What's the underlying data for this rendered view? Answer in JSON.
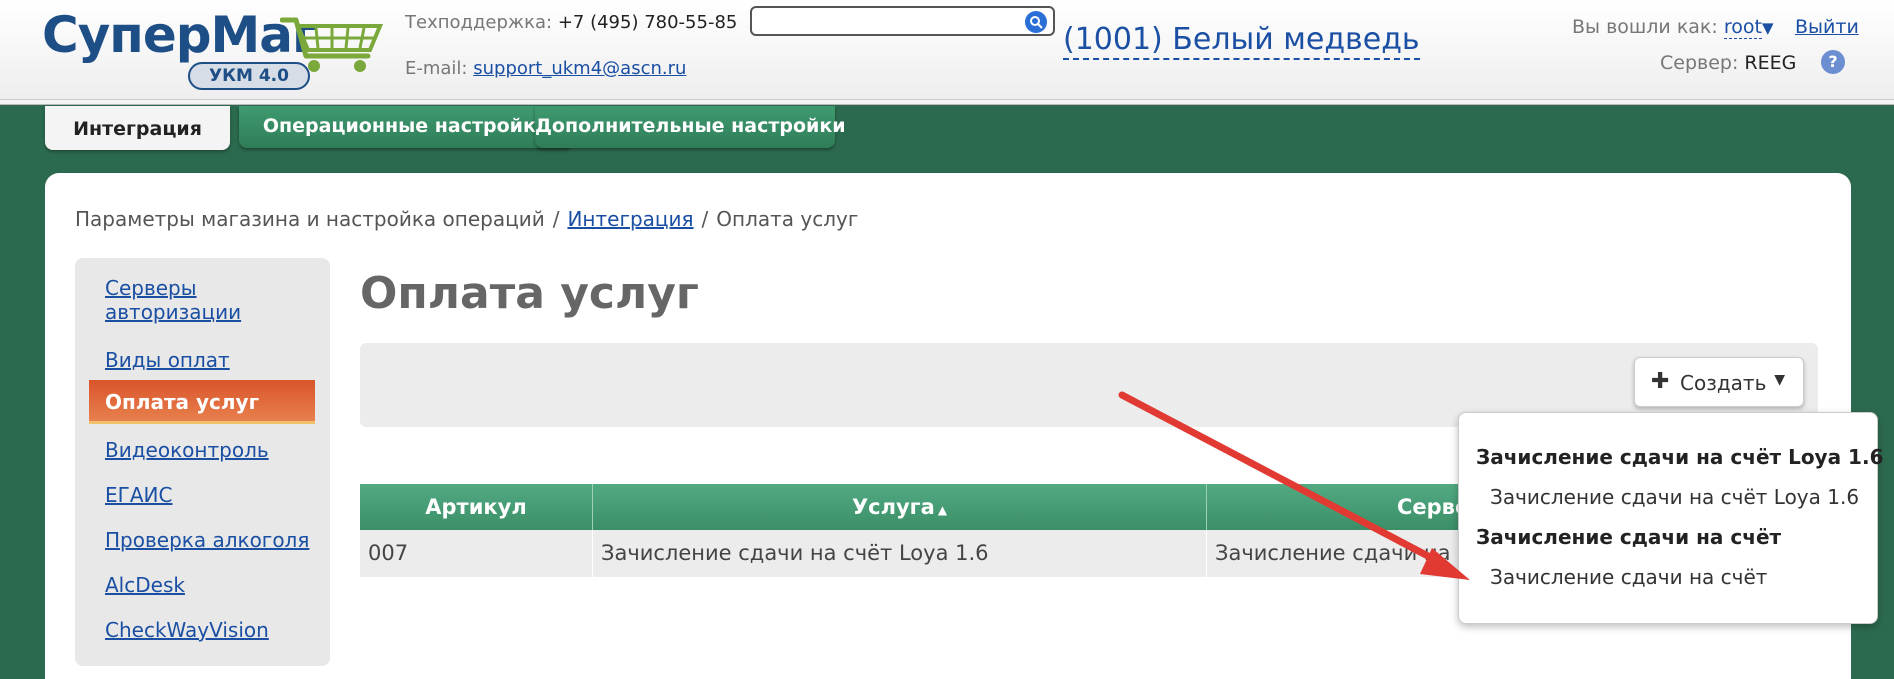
{
  "header": {
    "logo": {
      "title": "СуперМаг",
      "badge": "УКМ 4.0"
    },
    "support_label": "Техподдержка:",
    "support_phone": "+7 (495) 780-55-85",
    "email_label": "E-mail:",
    "email": "support_ukm4@ascn.ru",
    "search": {
      "value": "",
      "placeholder": ""
    },
    "store": "(1001) Белый медведь",
    "logged_in_label": "Вы вошли как:",
    "user": "root",
    "logout": "Выйти",
    "server_label": "Сервер:",
    "server": "REEG",
    "help": "?"
  },
  "tabs": [
    {
      "label": "Интеграция",
      "active": true
    },
    {
      "label": "Операционные настройки",
      "active": false
    },
    {
      "label": "Дополнительные настройки",
      "active": false
    }
  ],
  "breadcrumb": {
    "root": "Параметры магазина и настройка операций",
    "link": "Интеграция",
    "current": "Оплата услуг",
    "separator": "/"
  },
  "sidebar": {
    "items": [
      {
        "label": "Серверы авторизации",
        "active": false
      },
      {
        "label": "Виды оплат",
        "active": false
      },
      {
        "label": "Оплата услуг",
        "active": true
      },
      {
        "label": "Видеоконтроль",
        "active": false
      },
      {
        "label": "ЕГАИС",
        "active": false
      },
      {
        "label": "Проверка алкоголя",
        "active": false
      },
      {
        "label": "AlcDesk",
        "active": false
      },
      {
        "label": "CheckWayVision",
        "active": false
      }
    ]
  },
  "page_title": "Оплата услуг",
  "toolbar": {
    "create_label": "Создать",
    "create_icon": "plus-icon"
  },
  "table": {
    "columns": [
      "Артикул",
      "Услуга",
      "Серве"
    ],
    "sort_column": "Услуга",
    "rows": [
      {
        "article": "007",
        "service": "Зачисление сдачи на счёт Loya 1.6",
        "server": "Зачисление сдачи на"
      }
    ]
  },
  "create_menu": {
    "groups": [
      {
        "title": "Зачисление сдачи на счёт Loya 1.6",
        "items": [
          "Зачисление сдачи на счёт Loya 1.6"
        ]
      },
      {
        "title": "Зачисление сдачи на счёт",
        "items": [
          "Зачисление сдачи на счёт"
        ]
      }
    ]
  },
  "colors": {
    "background": "#2c6a4f",
    "accent_green": "#3f9a70",
    "active_orange": "#d9542a",
    "link_blue": "#1a4fa3",
    "arrow_red": "#e03a33"
  }
}
